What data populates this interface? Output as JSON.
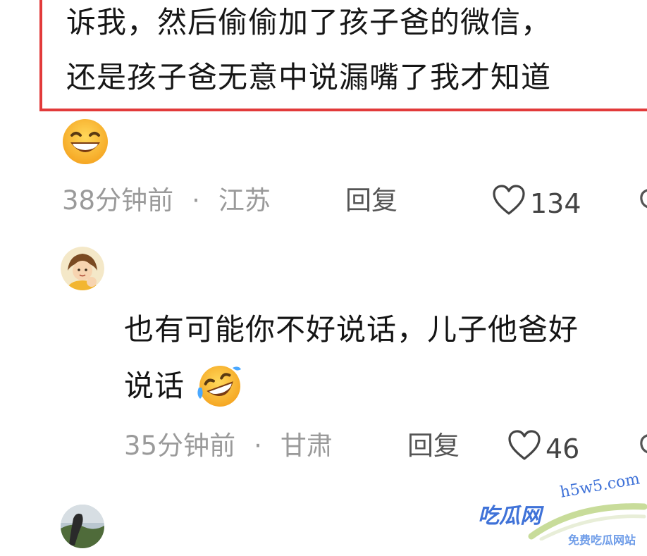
{
  "quoted_comment": {
    "line1": "诉我，然后偷偷加了孩子爸的微信，",
    "line2": "还是孩子爸无意中说漏嘴了我才知道"
  },
  "comments": [
    {
      "emoji_icon": "grinning-squint-emoji",
      "time": "38分钟前",
      "location": "江苏",
      "reply_label": "回复",
      "likes": "134"
    },
    {
      "avatar_icon": "cartoon-girl-avatar",
      "text_line1": "也有可能你不好说话，儿子他爸好",
      "text_line2": "说话",
      "text_emoji": "rolling-laughing-emoji",
      "time": "35分钟前",
      "location": "甘肃",
      "reply_label": "回复",
      "likes": "46"
    },
    {
      "avatar_icon": "landscape-photo-avatar"
    }
  ],
  "watermark": {
    "main": "吃瓜网",
    "url": "h5w5.com",
    "sub": "免费吃瓜网站"
  },
  "colors": {
    "quote_border": "#e23a3a",
    "meta_text": "#9a9a9a",
    "watermark": "#3f72d8"
  }
}
